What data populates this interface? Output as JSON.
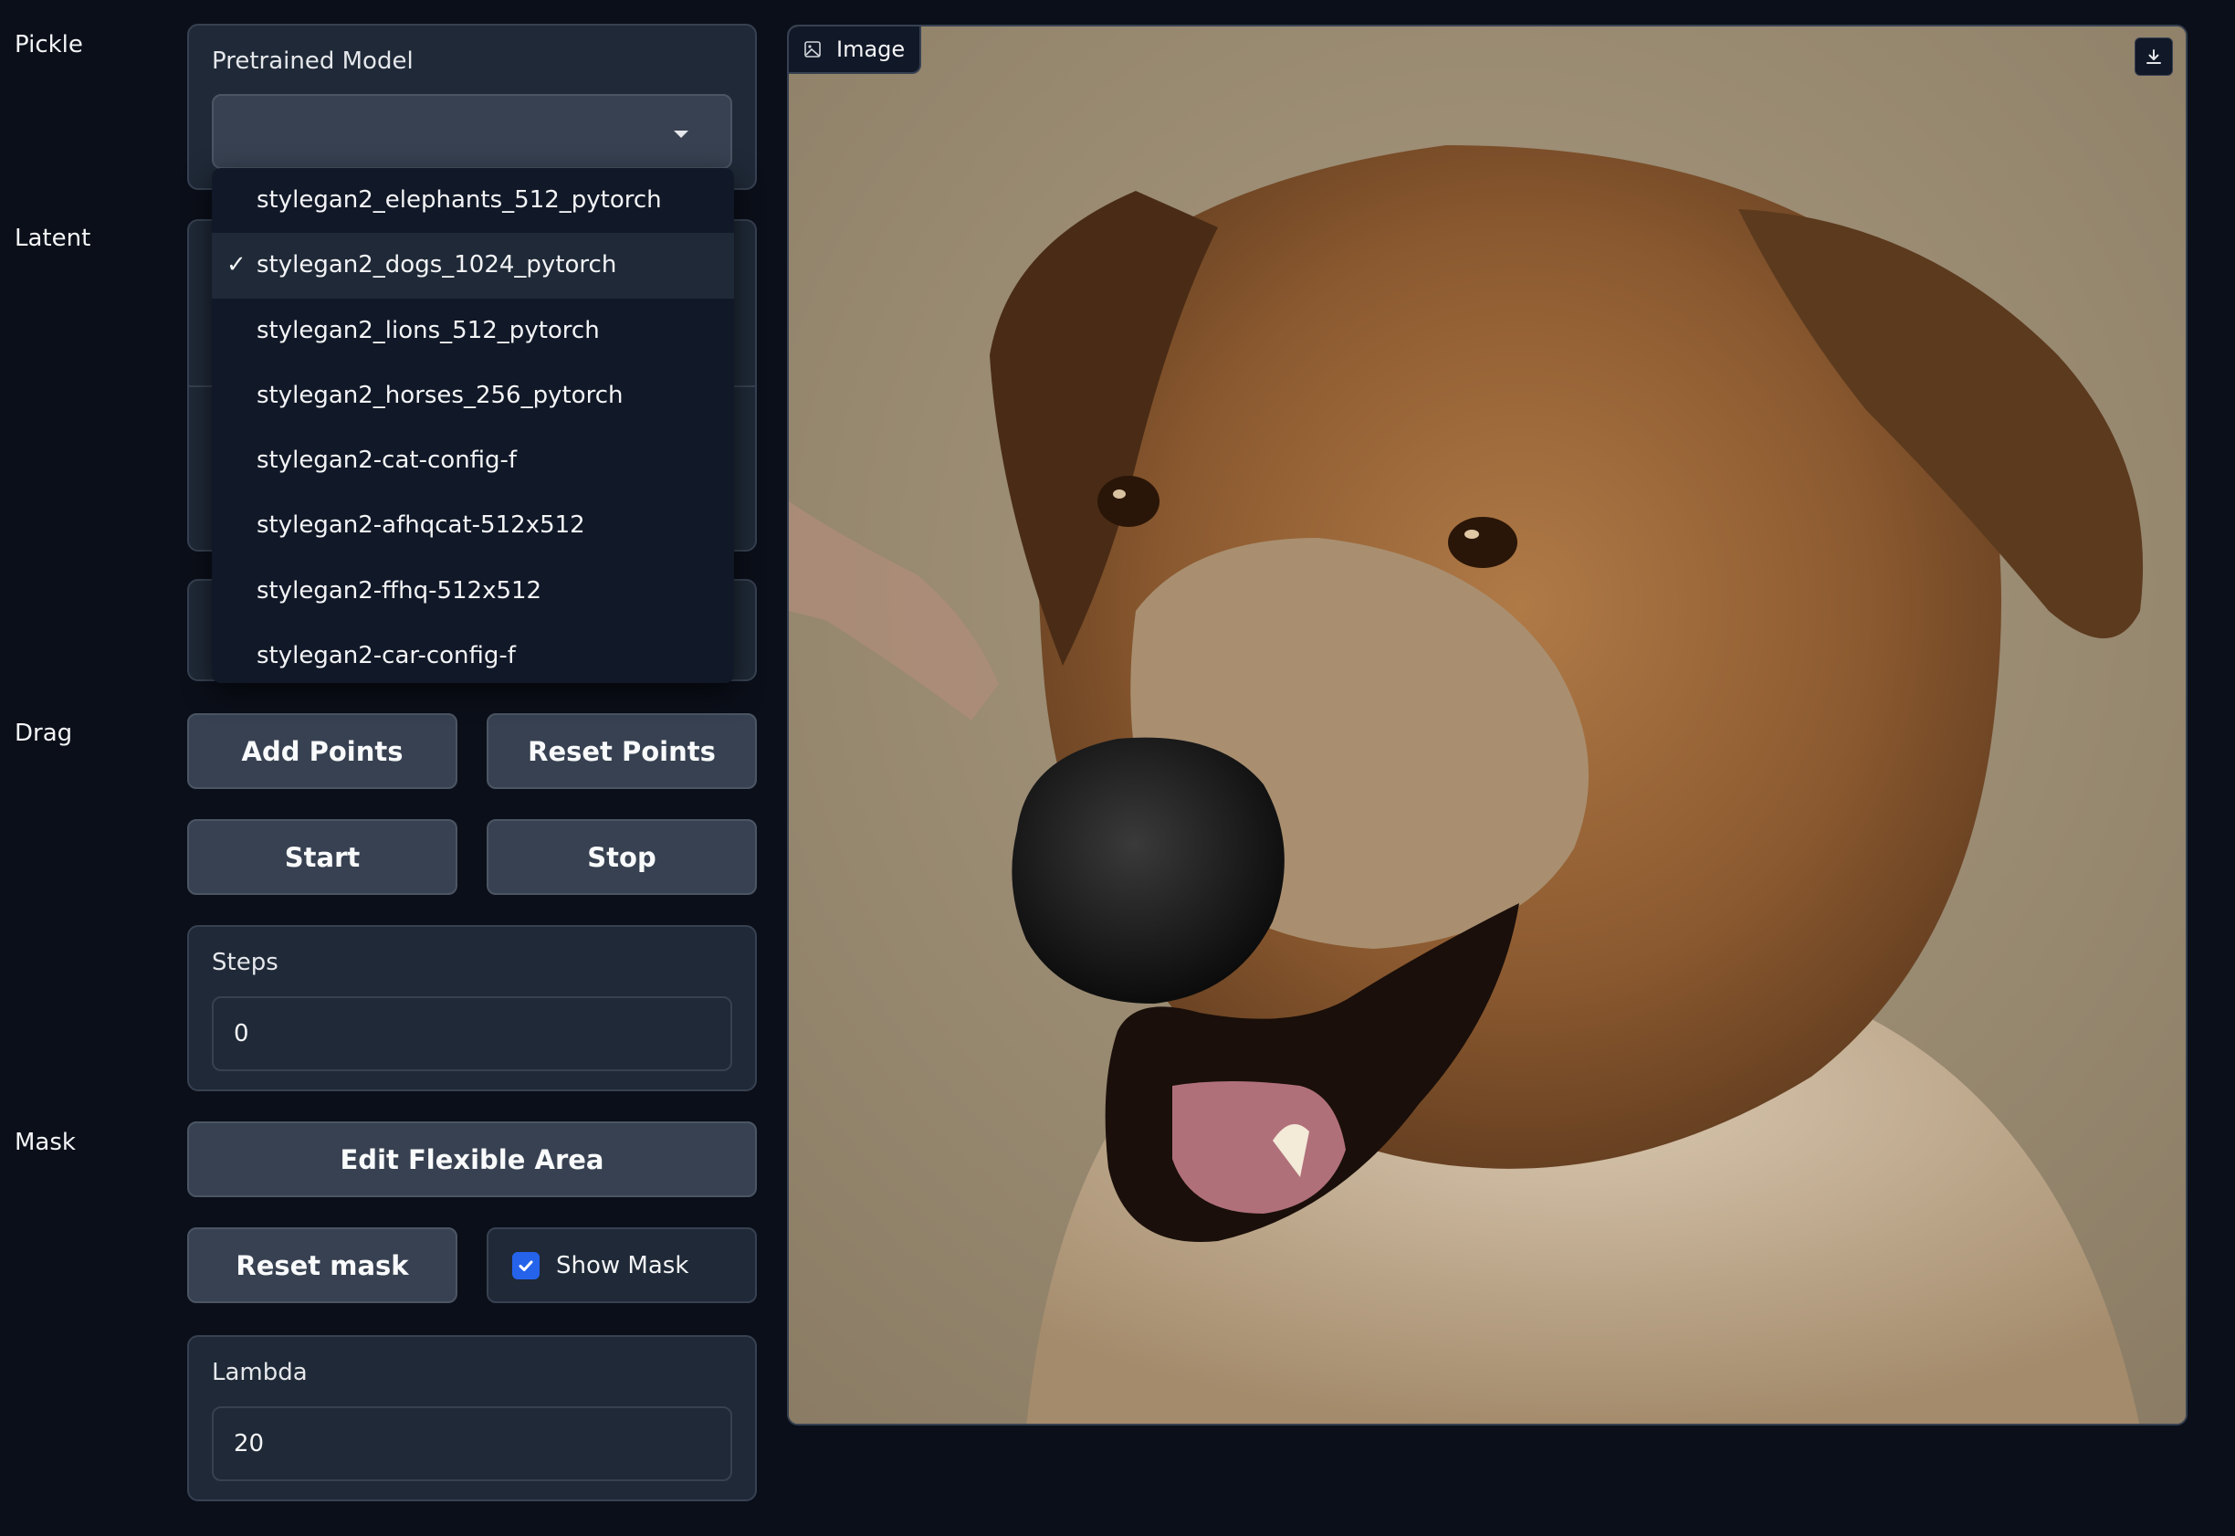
{
  "sections": {
    "pickle": "Pickle",
    "latent": "Latent",
    "drag": "Drag",
    "mask": "Mask"
  },
  "pretrained_model": {
    "label": "Pretrained Model",
    "value": "",
    "options": [
      "stylegan2_elephants_512_pytorch",
      "stylegan2_dogs_1024_pytorch",
      "stylegan2_lions_512_pytorch",
      "stylegan2_horses_256_pytorch",
      "stylegan2-cat-config-f",
      "stylegan2-afhqcat-512x512",
      "stylegan2-ffhq-512x512",
      "stylegan2-car-config-f"
    ],
    "selected": "stylegan2_dogs_1024_pytorch",
    "check_mark": "✓"
  },
  "drag": {
    "add_points": "Add Points",
    "reset_points": "Reset Points",
    "start": "Start",
    "stop": "Stop",
    "steps_label": "Steps",
    "steps_value": "0"
  },
  "mask": {
    "edit_flexible_area": "Edit Flexible Area",
    "reset_mask": "Reset mask",
    "show_mask_label": "Show Mask",
    "show_mask_checked": true,
    "lambda_label": "Lambda",
    "lambda_value": "20"
  },
  "image_panel": {
    "tag": "Image",
    "icons": {
      "tag": "image-icon",
      "download": "download-icon"
    }
  },
  "colors": {
    "background": "#0b0f19",
    "panel": "#1f2937",
    "border": "#374151",
    "button": "#374151",
    "checkbox_accent": "#2563eb"
  }
}
